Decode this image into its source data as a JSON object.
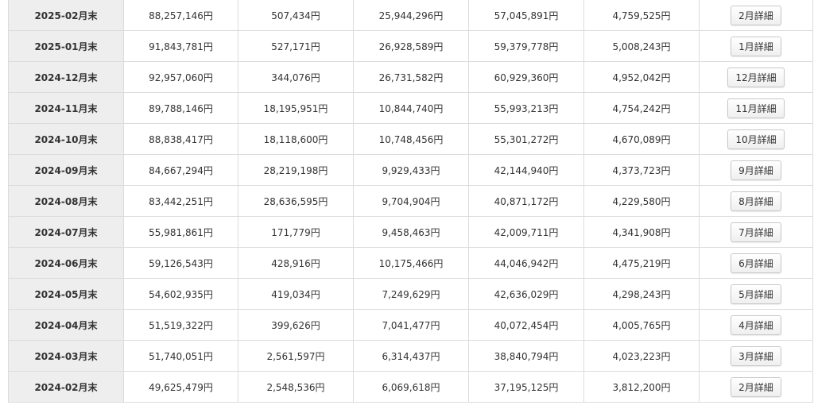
{
  "rows": [
    {
      "month": "2025-02月末",
      "c1": "88,257,146円",
      "c2": "507,434円",
      "c3": "25,944,296円",
      "c4": "57,045,891円",
      "c5": "4,759,525円",
      "button": "2月詳細"
    },
    {
      "month": "2025-01月末",
      "c1": "91,843,781円",
      "c2": "527,171円",
      "c3": "26,928,589円",
      "c4": "59,379,778円",
      "c5": "5,008,243円",
      "button": "1月詳細"
    },
    {
      "month": "2024-12月末",
      "c1": "92,957,060円",
      "c2": "344,076円",
      "c3": "26,731,582円",
      "c4": "60,929,360円",
      "c5": "4,952,042円",
      "button": "12月詳細"
    },
    {
      "month": "2024-11月末",
      "c1": "89,788,146円",
      "c2": "18,195,951円",
      "c3": "10,844,740円",
      "c4": "55,993,213円",
      "c5": "4,754,242円",
      "button": "11月詳細"
    },
    {
      "month": "2024-10月末",
      "c1": "88,838,417円",
      "c2": "18,118,600円",
      "c3": "10,748,456円",
      "c4": "55,301,272円",
      "c5": "4,670,089円",
      "button": "10月詳細"
    },
    {
      "month": "2024-09月末",
      "c1": "84,667,294円",
      "c2": "28,219,198円",
      "c3": "9,929,433円",
      "c4": "42,144,940円",
      "c5": "4,373,723円",
      "button": "9月詳細"
    },
    {
      "month": "2024-08月末",
      "c1": "83,442,251円",
      "c2": "28,636,595円",
      "c3": "9,704,904円",
      "c4": "40,871,172円",
      "c5": "4,229,580円",
      "button": "8月詳細"
    },
    {
      "month": "2024-07月末",
      "c1": "55,981,861円",
      "c2": "171,779円",
      "c3": "9,458,463円",
      "c4": "42,009,711円",
      "c5": "4,341,908円",
      "button": "7月詳細"
    },
    {
      "month": "2024-06月末",
      "c1": "59,126,543円",
      "c2": "428,916円",
      "c3": "10,175,466円",
      "c4": "44,046,942円",
      "c5": "4,475,219円",
      "button": "6月詳細"
    },
    {
      "month": "2024-05月末",
      "c1": "54,602,935円",
      "c2": "419,034円",
      "c3": "7,249,629円",
      "c4": "42,636,029円",
      "c5": "4,298,243円",
      "button": "5月詳細"
    },
    {
      "month": "2024-04月末",
      "c1": "51,519,322円",
      "c2": "399,626円",
      "c3": "7,041,477円",
      "c4": "40,072,454円",
      "c5": "4,005,765円",
      "button": "4月詳細"
    },
    {
      "month": "2024-03月末",
      "c1": "51,740,051円",
      "c2": "2,561,597円",
      "c3": "6,314,437円",
      "c4": "38,840,794円",
      "c5": "4,023,223円",
      "button": "3月詳細"
    },
    {
      "month": "2024-02月末",
      "c1": "49,625,479円",
      "c2": "2,548,536円",
      "c3": "6,069,618円",
      "c4": "37,195,125円",
      "c5": "3,812,200円",
      "button": "2月詳細"
    }
  ]
}
